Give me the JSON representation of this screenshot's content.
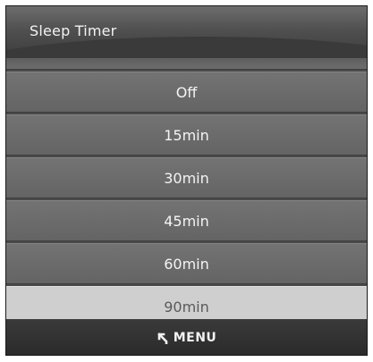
{
  "header": {
    "title": "Sleep Timer"
  },
  "options": [
    {
      "label": "Off"
    },
    {
      "label": "15min"
    },
    {
      "label": "30min"
    },
    {
      "label": "45min"
    },
    {
      "label": "60min"
    },
    {
      "label": "90min"
    }
  ],
  "selected_option": "90min",
  "footer": {
    "menu_icon": "return-arrow-icon",
    "menu_label": "MENU"
  }
}
